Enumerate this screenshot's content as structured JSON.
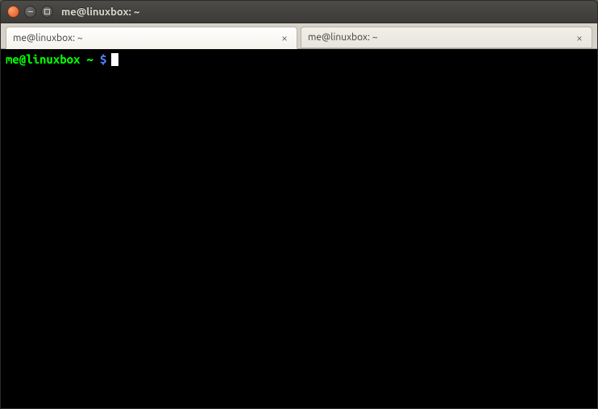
{
  "window": {
    "title": "me@linuxbox: ~"
  },
  "tabs": [
    {
      "label": "me@linuxbox: ~",
      "active": true
    },
    {
      "label": "me@linuxbox: ~",
      "active": false
    }
  ],
  "prompt": {
    "userhost": "me@linuxbox",
    "path": "~",
    "symbol": "$"
  }
}
